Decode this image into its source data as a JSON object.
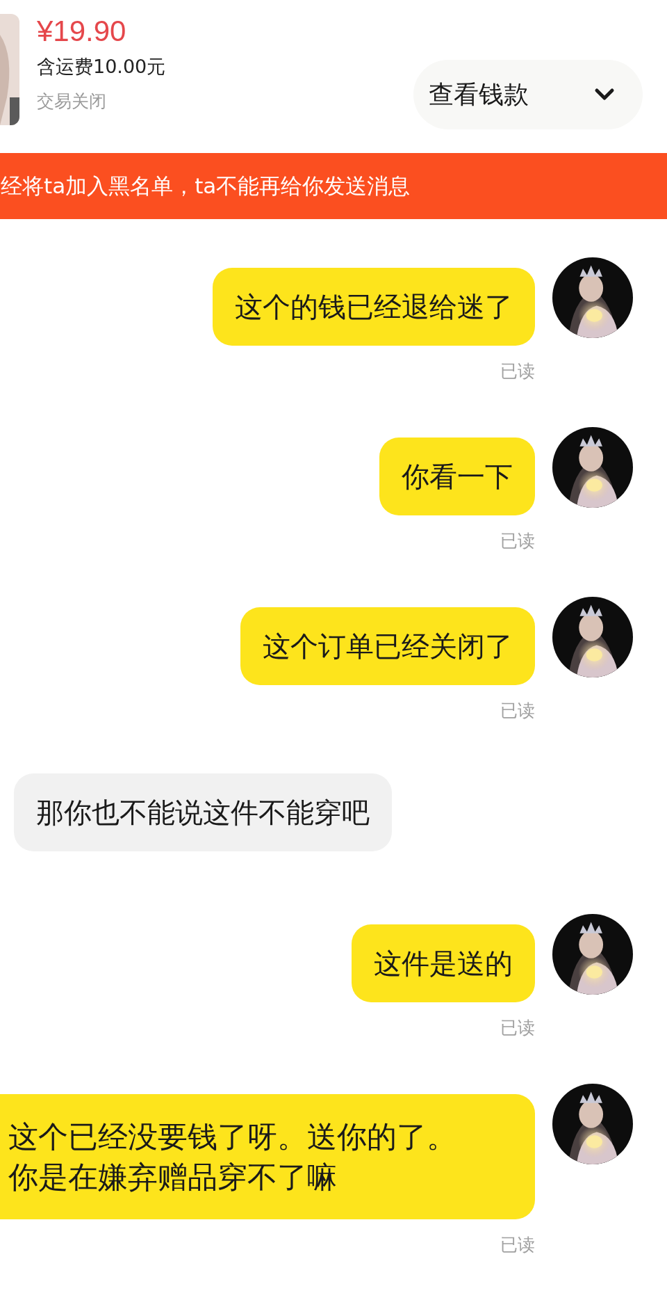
{
  "order": {
    "price": "¥19.90",
    "shipping": "含运费10.00元",
    "status": "交易关闭",
    "action_button": "查看钱款"
  },
  "banner": "经将ta加入黑名单，ta不能再给你发送消息",
  "messages": [
    {
      "kind": "outgoing",
      "text": "这个的钱已经退给迷了",
      "read_label": "已读"
    },
    {
      "kind": "outgoing",
      "text": "你看一下",
      "read_label": "已读"
    },
    {
      "kind": "outgoing",
      "text": "这个订单已经关闭了",
      "read_label": "已读"
    },
    {
      "kind": "incoming",
      "text": "那你也不能说这件不能穿吧"
    },
    {
      "kind": "outgoing",
      "text": "这件是送的",
      "read_label": "已读"
    },
    {
      "kind": "outgoing",
      "text": "这个已经没要钱了呀。送你的了。你是在嫌弃赠品穿不了嘛",
      "read_label": "已读"
    }
  ]
}
